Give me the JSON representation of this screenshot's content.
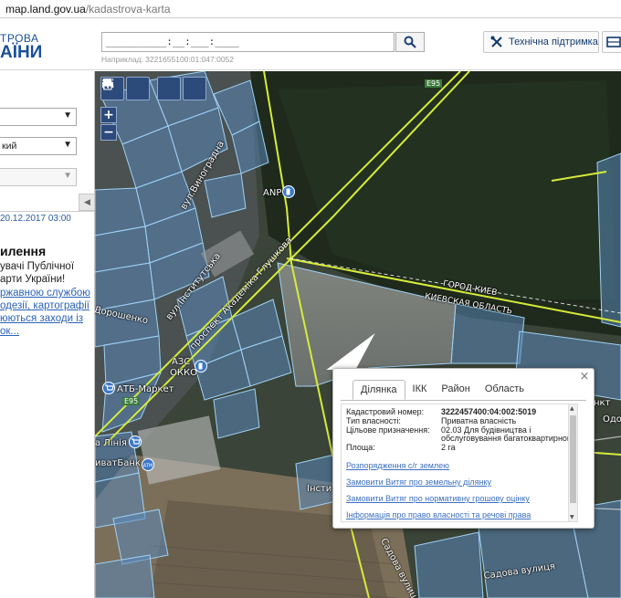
{
  "browser": {
    "host": "map.land.gov.ua",
    "path": "/kadastrova-karta"
  },
  "header": {
    "logo_top": "ТРОВА",
    "logo_bottom": "АЇНИ",
    "search_value": "__________:__:___:____",
    "search_hint": "Наприклад: 3221655100:01:047:0052",
    "support_label": "Технічна підтримка"
  },
  "sidebar": {
    "selects": [
      {
        "value": ""
      },
      {
        "value": "кий"
      },
      {
        "value": ""
      }
    ],
    "date": "20.12.2017 03:00",
    "news_title": "илення",
    "news_lines": [
      "увачі Публічної",
      "арти України!"
    ],
    "news_links": [
      "ржавною службою",
      "одезії, картографії",
      "юються заходи із",
      "ок..."
    ]
  },
  "map": {
    "labels": {
      "road_top": "E95",
      "road_left": "E95",
      "anp": "ANP",
      "street_vynogradna": "вул.Виноградна",
      "street_instytutska": "вул.Інститутська",
      "academika": "проспект Академіка Глушкова",
      "dorohoshenko": "Дорошенко",
      "gorod_kiev": "ГОРОД КИЕВ",
      "kyiv_oblast": "КИЕВСКАЯ ОБЛАСТЬ",
      "azs": "АЗС",
      "okko": "ОККО",
      "atb": "АТБ-Маркет",
      "liniya": "а Лінія",
      "privatbank": "иватБанк",
      "insti": "Інсти",
      "sadova1": "Садова вулиця",
      "sadova2": "Садова вулиця",
      "dobro_right": "нкт",
      "odo_right": "Одо"
    }
  },
  "popup": {
    "tabs": [
      "Ділянка",
      "ІКК",
      "Район",
      "Область"
    ],
    "active_tab": "Ділянка",
    "fields": [
      {
        "key": "Кадастровий номер:",
        "value": "3222457400:04:002:5019"
      },
      {
        "key": "Тип власності:",
        "value": "Приватна власність"
      },
      {
        "key": "Цільове призначення:",
        "value": "02.03 Для будівництва і"
      },
      {
        "key": "",
        "value": "обслуговування багатоквартирного житлового будинку"
      },
      {
        "key": "Площа:",
        "value": "2 га"
      }
    ],
    "links": [
      "Розпорядження с/г землею",
      "Замовити Витяг про земельну ділянку",
      "Замовити Витяг про нормативну грошову оцінку",
      "Інформація про право власності та речові права"
    ]
  },
  "colors": {
    "brand": "#1b4f99",
    "link": "#2a62b8",
    "parcel_fill": "#5a86b8",
    "parcel_stroke": "#9fd2f5",
    "boundary": "#d6ec3a"
  }
}
